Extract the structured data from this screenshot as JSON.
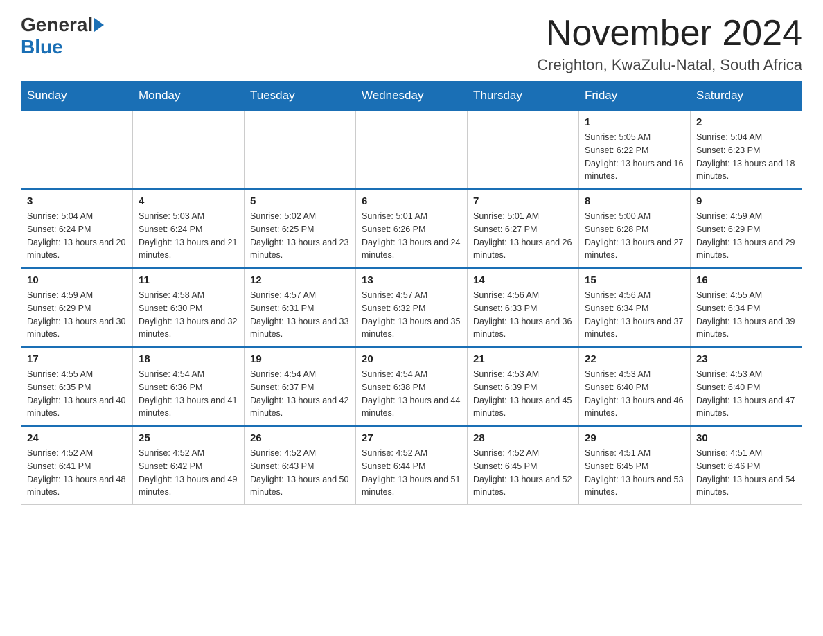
{
  "header": {
    "logo_general": "General",
    "logo_blue": "Blue",
    "month_title": "November 2024",
    "location": "Creighton, KwaZulu-Natal, South Africa"
  },
  "weekdays": [
    "Sunday",
    "Monday",
    "Tuesday",
    "Wednesday",
    "Thursday",
    "Friday",
    "Saturday"
  ],
  "weeks": [
    [
      {
        "day": "",
        "info": ""
      },
      {
        "day": "",
        "info": ""
      },
      {
        "day": "",
        "info": ""
      },
      {
        "day": "",
        "info": ""
      },
      {
        "day": "",
        "info": ""
      },
      {
        "day": "1",
        "info": "Sunrise: 5:05 AM\nSunset: 6:22 PM\nDaylight: 13 hours and 16 minutes."
      },
      {
        "day": "2",
        "info": "Sunrise: 5:04 AM\nSunset: 6:23 PM\nDaylight: 13 hours and 18 minutes."
      }
    ],
    [
      {
        "day": "3",
        "info": "Sunrise: 5:04 AM\nSunset: 6:24 PM\nDaylight: 13 hours and 20 minutes."
      },
      {
        "day": "4",
        "info": "Sunrise: 5:03 AM\nSunset: 6:24 PM\nDaylight: 13 hours and 21 minutes."
      },
      {
        "day": "5",
        "info": "Sunrise: 5:02 AM\nSunset: 6:25 PM\nDaylight: 13 hours and 23 minutes."
      },
      {
        "day": "6",
        "info": "Sunrise: 5:01 AM\nSunset: 6:26 PM\nDaylight: 13 hours and 24 minutes."
      },
      {
        "day": "7",
        "info": "Sunrise: 5:01 AM\nSunset: 6:27 PM\nDaylight: 13 hours and 26 minutes."
      },
      {
        "day": "8",
        "info": "Sunrise: 5:00 AM\nSunset: 6:28 PM\nDaylight: 13 hours and 27 minutes."
      },
      {
        "day": "9",
        "info": "Sunrise: 4:59 AM\nSunset: 6:29 PM\nDaylight: 13 hours and 29 minutes."
      }
    ],
    [
      {
        "day": "10",
        "info": "Sunrise: 4:59 AM\nSunset: 6:29 PM\nDaylight: 13 hours and 30 minutes."
      },
      {
        "day": "11",
        "info": "Sunrise: 4:58 AM\nSunset: 6:30 PM\nDaylight: 13 hours and 32 minutes."
      },
      {
        "day": "12",
        "info": "Sunrise: 4:57 AM\nSunset: 6:31 PM\nDaylight: 13 hours and 33 minutes."
      },
      {
        "day": "13",
        "info": "Sunrise: 4:57 AM\nSunset: 6:32 PM\nDaylight: 13 hours and 35 minutes."
      },
      {
        "day": "14",
        "info": "Sunrise: 4:56 AM\nSunset: 6:33 PM\nDaylight: 13 hours and 36 minutes."
      },
      {
        "day": "15",
        "info": "Sunrise: 4:56 AM\nSunset: 6:34 PM\nDaylight: 13 hours and 37 minutes."
      },
      {
        "day": "16",
        "info": "Sunrise: 4:55 AM\nSunset: 6:34 PM\nDaylight: 13 hours and 39 minutes."
      }
    ],
    [
      {
        "day": "17",
        "info": "Sunrise: 4:55 AM\nSunset: 6:35 PM\nDaylight: 13 hours and 40 minutes."
      },
      {
        "day": "18",
        "info": "Sunrise: 4:54 AM\nSunset: 6:36 PM\nDaylight: 13 hours and 41 minutes."
      },
      {
        "day": "19",
        "info": "Sunrise: 4:54 AM\nSunset: 6:37 PM\nDaylight: 13 hours and 42 minutes."
      },
      {
        "day": "20",
        "info": "Sunrise: 4:54 AM\nSunset: 6:38 PM\nDaylight: 13 hours and 44 minutes."
      },
      {
        "day": "21",
        "info": "Sunrise: 4:53 AM\nSunset: 6:39 PM\nDaylight: 13 hours and 45 minutes."
      },
      {
        "day": "22",
        "info": "Sunrise: 4:53 AM\nSunset: 6:40 PM\nDaylight: 13 hours and 46 minutes."
      },
      {
        "day": "23",
        "info": "Sunrise: 4:53 AM\nSunset: 6:40 PM\nDaylight: 13 hours and 47 minutes."
      }
    ],
    [
      {
        "day": "24",
        "info": "Sunrise: 4:52 AM\nSunset: 6:41 PM\nDaylight: 13 hours and 48 minutes."
      },
      {
        "day": "25",
        "info": "Sunrise: 4:52 AM\nSunset: 6:42 PM\nDaylight: 13 hours and 49 minutes."
      },
      {
        "day": "26",
        "info": "Sunrise: 4:52 AM\nSunset: 6:43 PM\nDaylight: 13 hours and 50 minutes."
      },
      {
        "day": "27",
        "info": "Sunrise: 4:52 AM\nSunset: 6:44 PM\nDaylight: 13 hours and 51 minutes."
      },
      {
        "day": "28",
        "info": "Sunrise: 4:52 AM\nSunset: 6:45 PM\nDaylight: 13 hours and 52 minutes."
      },
      {
        "day": "29",
        "info": "Sunrise: 4:51 AM\nSunset: 6:45 PM\nDaylight: 13 hours and 53 minutes."
      },
      {
        "day": "30",
        "info": "Sunrise: 4:51 AM\nSunset: 6:46 PM\nDaylight: 13 hours and 54 minutes."
      }
    ]
  ]
}
